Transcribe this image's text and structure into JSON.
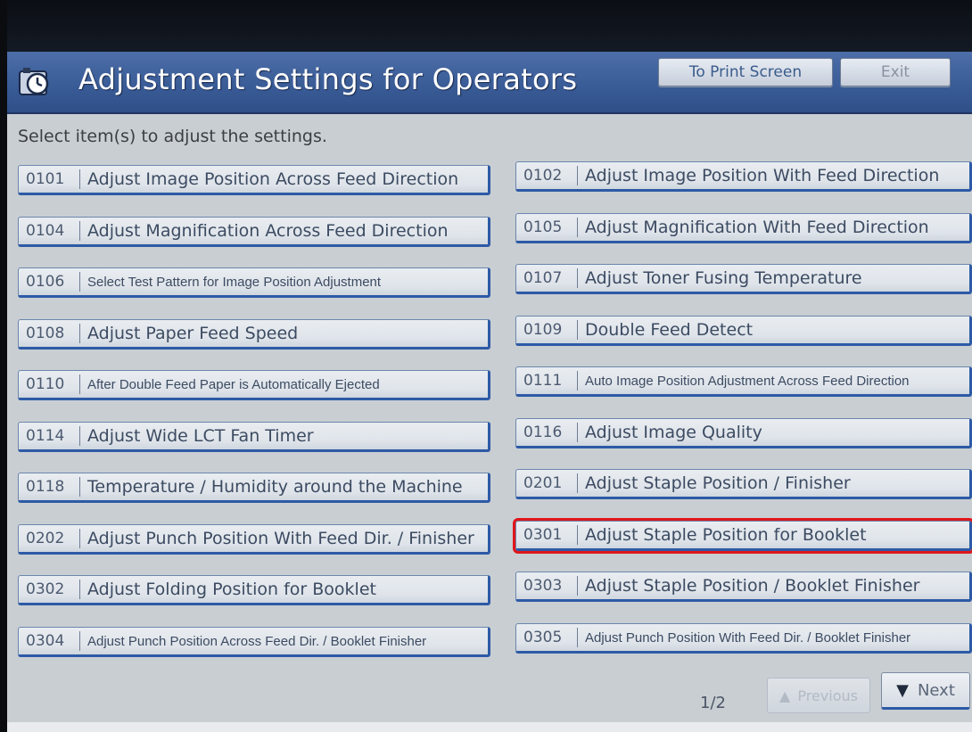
{
  "header": {
    "title": "Adjustment Settings for Operators",
    "print_button": "To Print Screen",
    "exit_button": "Exit"
  },
  "instruction": "Select item(s) to adjust the settings.",
  "items_left": [
    {
      "code": "0101",
      "label": "Adjust Image Position Across Feed Direction"
    },
    {
      "code": "0104",
      "label": "Adjust Magnification Across Feed Direction"
    },
    {
      "code": "0106",
      "label": "Select Test Pattern for Image Position Adjustment"
    },
    {
      "code": "0108",
      "label": "Adjust Paper Feed Speed"
    },
    {
      "code": "0110",
      "label": "After Double Feed Paper is Automatically Ejected"
    },
    {
      "code": "0114",
      "label": "Adjust Wide LCT Fan Timer"
    },
    {
      "code": "0118",
      "label": "Temperature / Humidity around the Machine"
    },
    {
      "code": "0202",
      "label": "Adjust Punch Position With Feed Dir. / Finisher"
    },
    {
      "code": "0302",
      "label": "Adjust Folding Position for Booklet"
    },
    {
      "code": "0304",
      "label": "Adjust Punch Position Across Feed Dir. / Booklet Finisher"
    }
  ],
  "items_right": [
    {
      "code": "0102",
      "label": "Adjust Image Position With Feed Direction"
    },
    {
      "code": "0105",
      "label": "Adjust Magnification With Feed Direction"
    },
    {
      "code": "0107",
      "label": "Adjust Toner Fusing Temperature"
    },
    {
      "code": "0109",
      "label": "Double Feed Detect"
    },
    {
      "code": "0111",
      "label": "Auto Image Position Adjustment Across Feed Direction"
    },
    {
      "code": "0116",
      "label": "Adjust Image Quality"
    },
    {
      "code": "0201",
      "label": "Adjust Staple Position / Finisher"
    },
    {
      "code": "0301",
      "label": "Adjust Staple Position for Booklet"
    },
    {
      "code": "0303",
      "label": "Adjust Staple Position / Booklet Finisher"
    },
    {
      "code": "0305",
      "label": "Adjust Punch Position With Feed Dir. / Booklet Finisher"
    }
  ],
  "pager": {
    "page": "1/2",
    "prev_label": "Previous",
    "next_label": "Next"
  },
  "icons": {
    "header": "settings-clock-icon",
    "next": "triangle-down-icon",
    "prev": "triangle-up-icon"
  },
  "colors": {
    "header_blue": "#3a5c97",
    "button_border": "#2d5aa6",
    "highlight": "#e0161b"
  }
}
